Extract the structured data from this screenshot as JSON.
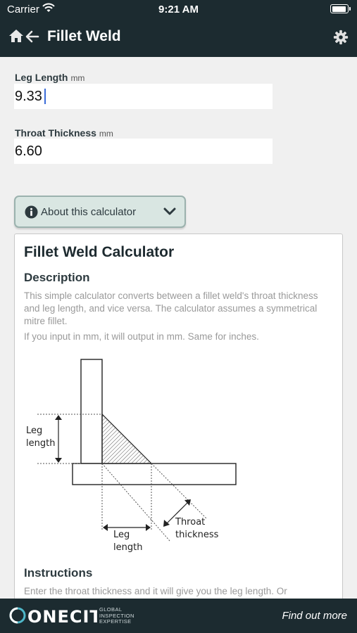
{
  "status_bar": {
    "carrier": "Carrier",
    "time": "9:21 AM"
  },
  "nav": {
    "title": "Fillet Weld",
    "home_icon": "home-icon",
    "back_icon": "back-arrow-icon",
    "settings_icon": "gear-icon"
  },
  "form": {
    "leg_length": {
      "label": "Leg Length",
      "unit": "mm",
      "value": "9.33"
    },
    "throat_thickness": {
      "label": "Throat Thickness",
      "unit": "mm",
      "value": "6.60"
    }
  },
  "about": {
    "label": "About this calculator",
    "expanded": true
  },
  "info": {
    "title": "Fillet Weld Calculator",
    "description_heading": "Description",
    "description_text": "This simple calculator converts between a fillet weld's throat thickness and leg length, and vice versa. The calculator assumes a symmetrical mitre fillet.",
    "description_note": "If you input in mm, it will output in mm. Same for inches.",
    "diagram": {
      "leg_label_left_1": "Leg",
      "leg_label_left_2": "length",
      "leg_label_bottom_1": "Leg",
      "leg_label_bottom_2": "length",
      "throat_label_1": "Throat",
      "throat_label_2": "thickness"
    },
    "instructions_heading": "Instructions",
    "instructions_text": "Enter the throat thickness and it will give you the leg length. Or"
  },
  "footer": {
    "brand": "ONECIT",
    "tagline_1": "GLOBAL",
    "tagline_2": "INSPECTION",
    "tagline_3": "EXPERTISE",
    "cta": "Find out more"
  },
  "colors": {
    "header_bg": "#1c2b30",
    "accent": "#3b6cd9",
    "about_bg": "#d9e6e2",
    "logo_teal": "#4fb8c9"
  }
}
